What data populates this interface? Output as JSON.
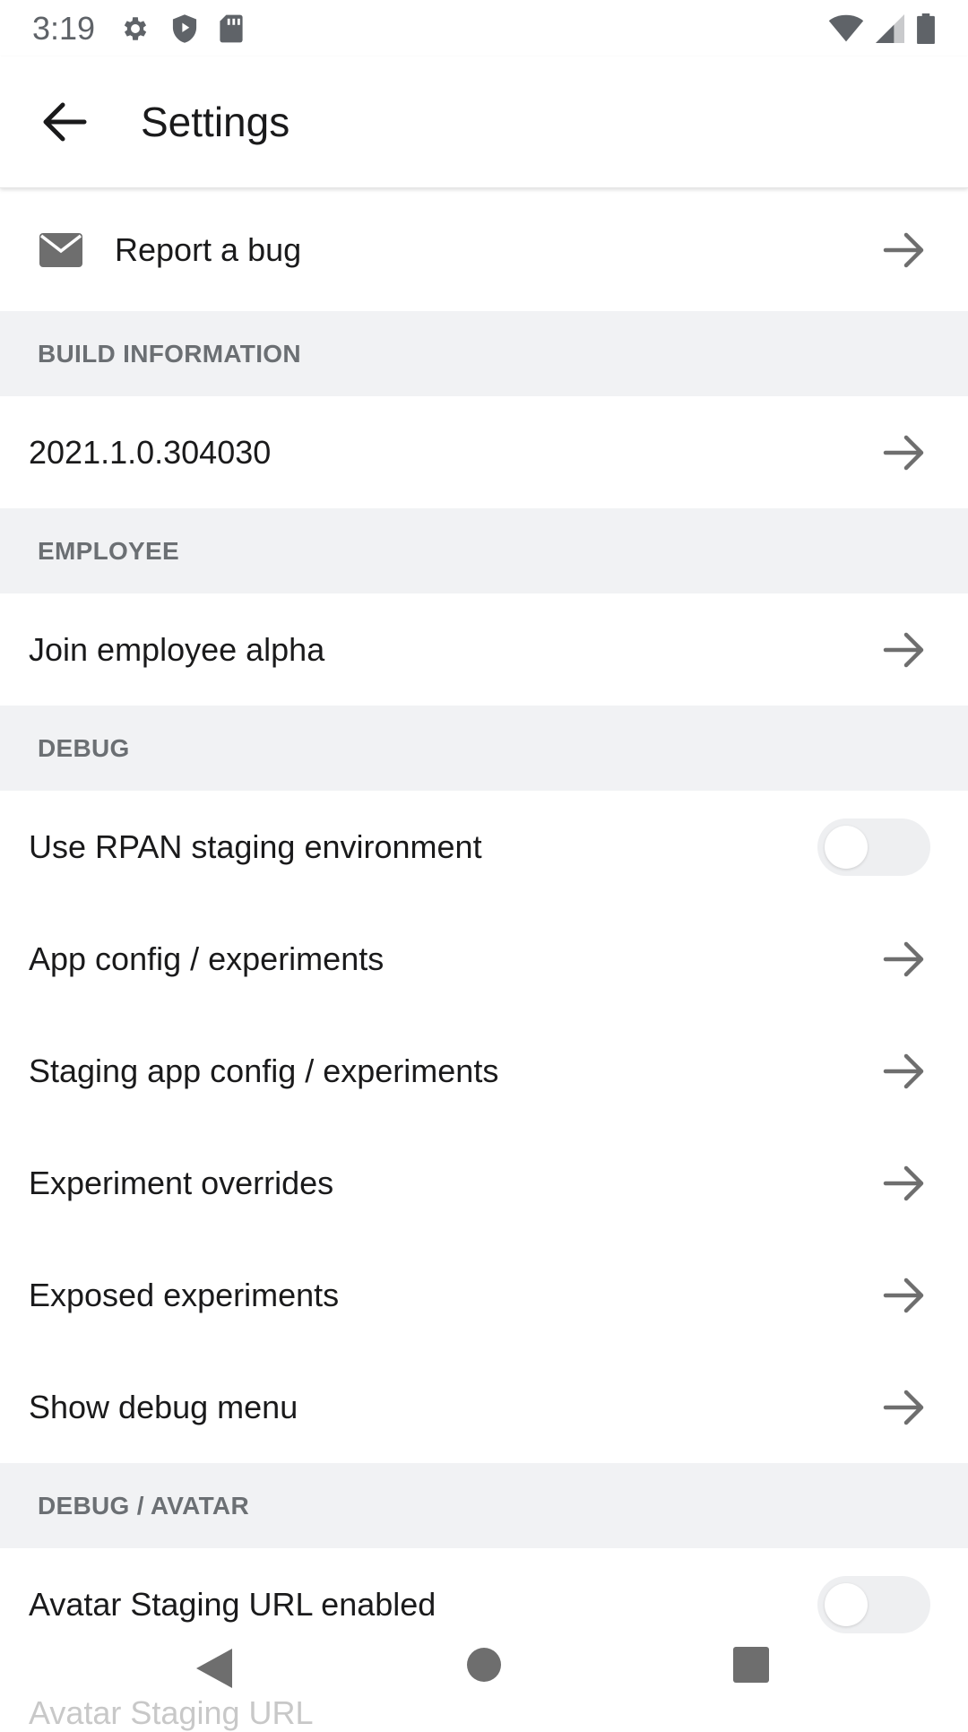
{
  "status_bar": {
    "time": "3:19",
    "left_icons": [
      "settings-icon",
      "shield-icon",
      "sd-card-icon"
    ],
    "right_icons": [
      "wifi-icon",
      "cell-signal-icon",
      "battery-icon"
    ]
  },
  "app_bar": {
    "title": "Settings",
    "back_icon": "arrow-left-icon"
  },
  "rows": {
    "report_bug": {
      "label": "Report a bug",
      "icon": "mail-icon"
    },
    "build_version": {
      "label": "2021.1.0.304030"
    },
    "join_alpha": {
      "label": "Join employee alpha"
    },
    "rpan_staging": {
      "label": "Use RPAN staging environment",
      "toggle_on": false
    },
    "app_config": {
      "label": "App config / experiments"
    },
    "staging_config": {
      "label": "Staging app config / experiments"
    },
    "experiment_overrides": {
      "label": "Experiment overrides"
    },
    "exposed_experiments": {
      "label": "Exposed experiments"
    },
    "debug_menu": {
      "label": "Show debug menu"
    },
    "avatar_staging_enabled": {
      "label": "Avatar Staging URL enabled",
      "toggle_on": false
    },
    "avatar_staging_url": {
      "label": "Avatar Staging URL"
    }
  },
  "sections": {
    "build_information": "BUILD INFORMATION",
    "employee": "EMPLOYEE",
    "debug": "DEBUG",
    "debug_avatar": "DEBUG / AVATAR"
  },
  "nav_bar": {
    "icons": [
      "nav-back-icon",
      "nav-home-icon",
      "nav-recents-icon"
    ]
  },
  "colors": {
    "section_bg": "#f1f2f4",
    "section_text": "#6b6f73",
    "text_primary": "#1a1a1b",
    "arrow": "#6e6e6e",
    "toggle_track": "#eeeff1"
  }
}
